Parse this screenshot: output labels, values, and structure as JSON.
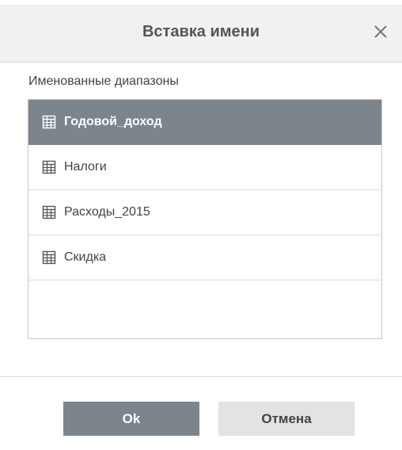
{
  "dialog": {
    "title": "Вставка имени",
    "close_icon": "close-icon"
  },
  "section": {
    "label": "Именованные диапазоны"
  },
  "ranges": [
    {
      "name": "Годовой_доход",
      "icon": "table-range-icon",
      "selected": true
    },
    {
      "name": "Налоги",
      "icon": "table-range-icon",
      "selected": false
    },
    {
      "name": "Расходы_2015",
      "icon": "table-range-icon",
      "selected": false
    },
    {
      "name": "Скидка",
      "icon": "table-range-icon",
      "selected": false
    }
  ],
  "buttons": {
    "ok_label": "Ok",
    "cancel_label": "Отмена"
  },
  "colors": {
    "selected_row": "#7d858c",
    "ok_button": "#7d858c",
    "cancel_button": "#e3e3e3",
    "header_bg": "#f1f1f1"
  }
}
